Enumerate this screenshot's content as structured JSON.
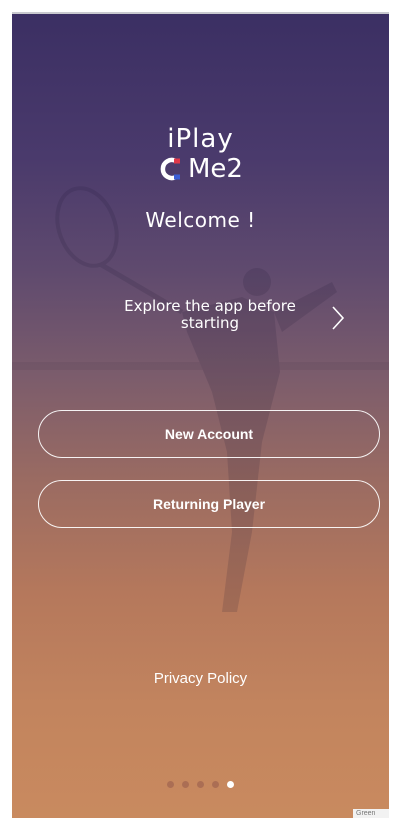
{
  "logo": {
    "line1": "iPlay",
    "line2": "Me2",
    "icon": "magnet-icon",
    "icon_colors": {
      "red": "#e0384a",
      "blue": "#3b5ed6",
      "white": "#ffffff"
    }
  },
  "welcome": "Welcome !",
  "explore": {
    "label": "Explore the app before starting",
    "icon": "chevron-right-icon"
  },
  "buttons": {
    "new_account": "New Account",
    "returning_player": "Returning Player"
  },
  "privacy_policy": "Privacy Policy",
  "pager": {
    "total": 5,
    "active_index": 4
  },
  "badge_text": "Green",
  "colors": {
    "background_top": "#3b2f63",
    "background_bottom": "#c98a5f",
    "text": "#ffffff"
  }
}
